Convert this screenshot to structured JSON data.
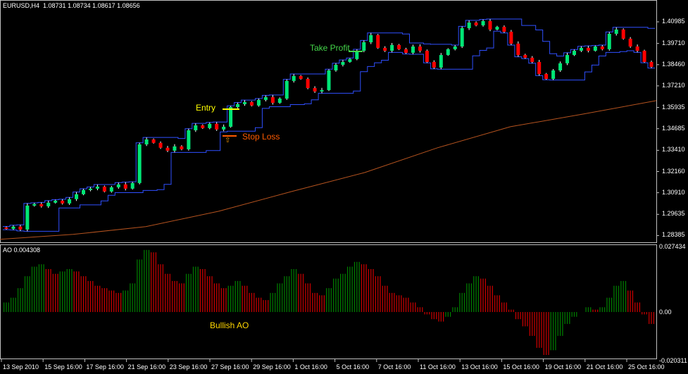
{
  "header": {
    "symbol": "EURUSD,H4",
    "ohlc": "1.08731 1.08734 1.08617 1.08656"
  },
  "colors": {
    "bull": "#00e676",
    "bear": "#ff0000",
    "channel": "#2f4fff",
    "ma": "#b5531f",
    "ao_up": "#008000",
    "ao_down": "#d00000",
    "entry": "#ffff00",
    "stop": "#ff5a00",
    "take_profit": "#44d64a",
    "bullish_ao": "#ffd700",
    "grid": "#c0c0c0"
  },
  "annotations": {
    "entry": "Entry",
    "stop_loss": "Stop Loss",
    "take_profit": "Take Profit",
    "bullish_ao": "Bullish AO",
    "stop_arrow": "⇧"
  },
  "chart_data": [
    {
      "type": "candlestick",
      "title": "EURUSD,H4",
      "y_ticks": [
        "1.40985",
        "1.39710",
        "1.38460",
        "1.37210",
        "1.35935",
        "1.34685",
        "1.33410",
        "1.32160",
        "1.30910",
        "1.29635",
        "1.28385"
      ],
      "ylim": [
        1.283,
        1.415
      ],
      "x_ticks": [
        "13 Sep 2010",
        "15 Sep 16:00",
        "17 Sep 16:00",
        "21 Sep 16:00",
        "23 Sep 16:00",
        "27 Sep 16:00",
        "29 Sep 16:00",
        "1 Oct 16:00",
        "5 Oct 16:00",
        "7 Oct 16:00",
        "11 Oct 16:00",
        "13 Oct 16:00",
        "15 Oct 16:00",
        "19 Oct 16:00",
        "21 Oct 16:00",
        "25 Oct 16:00"
      ],
      "close": [
        1.2878,
        1.2891,
        1.2874,
        1.3015,
        1.3024,
        1.3011,
        1.3032,
        1.3044,
        1.3028,
        1.3053,
        1.3082,
        1.3107,
        1.3115,
        1.3127,
        1.3098,
        1.3123,
        1.314,
        1.3115,
        1.3148,
        1.3376,
        1.3405,
        1.3385,
        1.3356,
        1.3339,
        1.3364,
        1.3347,
        1.3459,
        1.3488,
        1.3472,
        1.3497,
        1.3464,
        1.348,
        1.3596,
        1.3613,
        1.3625,
        1.3605,
        1.3638,
        1.3654,
        1.3621,
        1.3646,
        1.375,
        1.3779,
        1.3762,
        1.3708,
        1.3688,
        1.3696,
        1.3812,
        1.3845,
        1.3862,
        1.3879,
        1.3928,
        1.3978,
        1.402,
        1.3945,
        1.3928,
        1.3962,
        1.3937,
        1.3916,
        1.3953,
        1.3928,
        1.3862,
        1.3829,
        1.3903,
        1.3937,
        1.3953,
        1.4061,
        1.4094,
        1.4078,
        1.4103,
        1.4053,
        1.4069,
        1.404,
        1.397,
        1.3903,
        1.3887,
        1.3862,
        1.3791,
        1.3762,
        1.3812,
        1.3854,
        1.3903,
        1.3928,
        1.3945,
        1.3928,
        1.3953,
        1.3937,
        1.4028,
        1.4053,
        1.3999,
        1.3953,
        1.3928,
        1.3862,
        1.3833
      ],
      "moving_average": [
        1.2816,
        1.2845,
        1.2891,
        1.2982,
        1.3098,
        1.321,
        1.3356,
        1.348,
        1.3555,
        1.3634
      ]
    },
    {
      "type": "bar",
      "title": "AO 0.004308",
      "y_ticks": [
        "0.027434",
        "0.00",
        "-0.020311"
      ],
      "ylim": [
        -0.020311,
        0.027434
      ],
      "values": [
        0.004,
        0.006,
        0.01,
        0.015,
        0.019,
        0.02,
        0.018,
        0.016,
        0.017,
        0.018,
        0.017,
        0.015,
        0.013,
        0.011,
        0.01,
        0.009,
        0.008,
        0.009,
        0.012,
        0.022,
        0.026,
        0.025,
        0.02,
        0.016,
        0.013,
        0.012,
        0.016,
        0.019,
        0.018,
        0.015,
        0.012,
        0.01,
        0.011,
        0.013,
        0.011,
        0.008,
        0.006,
        0.005,
        0.008,
        0.012,
        0.015,
        0.018,
        0.016,
        0.012,
        0.008,
        0.007,
        0.01,
        0.014,
        0.016,
        0.019,
        0.021,
        0.02,
        0.018,
        0.015,
        0.011,
        0.008,
        0.007,
        0.006,
        0.004,
        0.002,
        -0.001,
        -0.003,
        -0.004,
        -0.002,
        0.002,
        0.008,
        0.012,
        0.015,
        0.014,
        0.011,
        0.007,
        0.004,
        0.001,
        -0.003,
        -0.006,
        -0.01,
        -0.015,
        -0.018,
        -0.016,
        -0.01,
        -0.005,
        -0.002,
        0.0,
        0.002,
        0.001,
        0.002,
        0.006,
        0.011,
        0.013,
        0.009,
        0.004,
        -0.001,
        -0.005
      ]
    }
  ]
}
